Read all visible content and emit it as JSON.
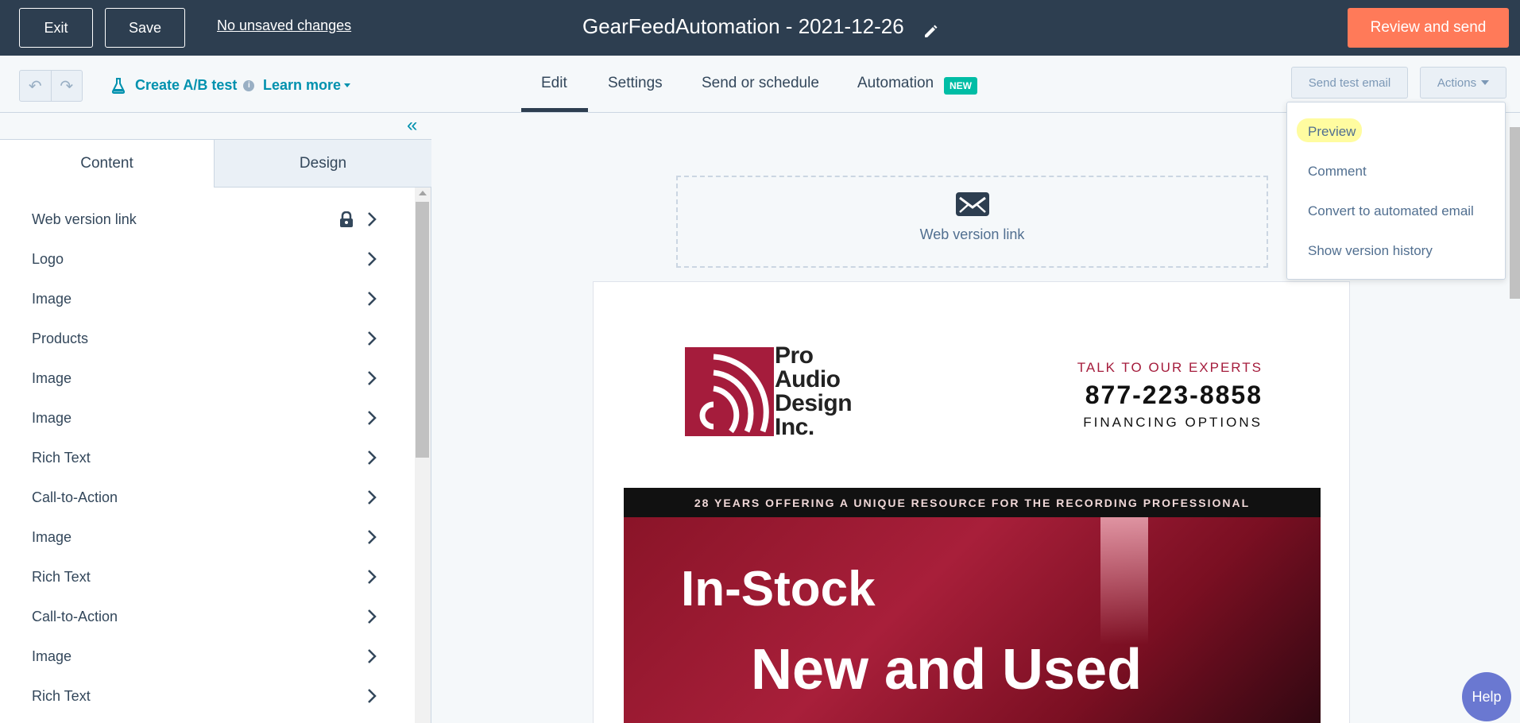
{
  "topbar": {
    "exit_label": "Exit",
    "save_label": "Save",
    "unsaved_label": "No unsaved changes",
    "title": "GearFeedAutomation - 2021-12-26",
    "review_label": "Review and send",
    "review_color": "#ff7a59",
    "bg_color": "#2d3e50"
  },
  "subbar": {
    "ab_test_label": "Create A/B test",
    "learn_more_label": "Learn more",
    "tabs": [
      {
        "label": "Edit",
        "active": true
      },
      {
        "label": "Settings",
        "active": false
      },
      {
        "label": "Send or schedule",
        "active": false
      },
      {
        "label": "Automation",
        "active": false
      }
    ],
    "new_badge": "NEW",
    "send_test_label": "Send test email",
    "actions_label": "Actions"
  },
  "sidebar": {
    "tabs": [
      "Content",
      "Design"
    ],
    "modules": [
      {
        "label": "Web version link",
        "locked": true
      },
      {
        "label": "Logo",
        "locked": false
      },
      {
        "label": "Image",
        "locked": false
      },
      {
        "label": "Products",
        "locked": false
      },
      {
        "label": "Image",
        "locked": false
      },
      {
        "label": "Image",
        "locked": false
      },
      {
        "label": "Rich Text",
        "locked": false
      },
      {
        "label": "Call-to-Action",
        "locked": false
      },
      {
        "label": "Image",
        "locked": false
      },
      {
        "label": "Rich Text",
        "locked": false
      },
      {
        "label": "Call-to-Action",
        "locked": false
      },
      {
        "label": "Image",
        "locked": false
      },
      {
        "label": "Rich Text",
        "locked": false
      }
    ]
  },
  "canvas": {
    "web_version_label": "Web version link",
    "logo_lines": [
      "Pro",
      "Audio",
      "Design",
      "Inc."
    ],
    "experts_line1": "TALK TO OUR EXPERTS",
    "phone": "877-223-8858",
    "financing": "FINANCING OPTIONS",
    "hero_band": "28 YEARS OFFERING A UNIQUE RESOURCE FOR THE RECORDING PROFESSIONAL",
    "hero_line1": "In-Stock",
    "hero_line2": "New and Used",
    "brand_color": "#a51c3c"
  },
  "actions_menu": {
    "items": [
      "Preview",
      "Comment",
      "Convert to automated email",
      "Show version history"
    ],
    "highlighted": "Preview"
  },
  "help_label": "Help"
}
